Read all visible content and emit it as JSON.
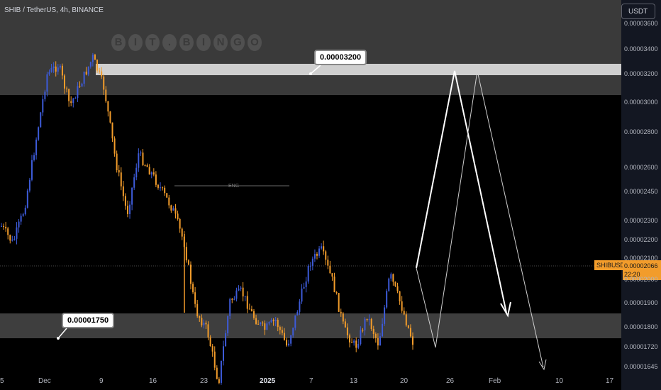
{
  "header": {
    "title": "SHIB / TetherUS, 4h, BINANCE",
    "currency_button": "USDT"
  },
  "watermark": [
    "B",
    "I",
    "T",
    ".",
    "B",
    "I",
    "N",
    "G",
    "O"
  ],
  "annotations": {
    "upper_callout": "0.00003200",
    "lower_callout": "0.00001750",
    "eng_label": "ENG"
  },
  "price_label": {
    "symbol": "SHIBUSDT",
    "price": "0.00002066",
    "timer": "22:20"
  },
  "colors": {
    "up_candle": "#3d5bd9",
    "down_candle": "#f29c2b",
    "zone": "#d0d0d0",
    "price_tag": "#f29c2b"
  },
  "chart_data": {
    "type": "candlestick",
    "y_ticks": [
      "0.00003600",
      "0.00003400",
      "0.00003200",
      "0.00003000",
      "0.00002800",
      "0.00002600",
      "0.00002450",
      "0.00002300",
      "0.00002200",
      "0.00002100",
      "0.00002000",
      "0.00001900",
      "0.00001800",
      "0.00001720",
      "0.00001645"
    ],
    "x_ticks": [
      "5",
      "Dec",
      "9",
      "16",
      "23",
      "2025",
      "7",
      "13",
      "20",
      "26",
      "Feb",
      "10",
      "17"
    ],
    "bold_x_ticks": [
      "2025"
    ],
    "resistance_zone": {
      "price": 3.2e-05,
      "label": "0.00003200"
    },
    "support_zone": {
      "price": 1.75e-05,
      "label": "0.00001750"
    },
    "last_price": 2.066e-05,
    "price_path": [
      2.55e-05,
      2.48e-05,
      2.62e-05,
      2.9e-05,
      3.18e-05,
      3.22e-05,
      3.05e-05,
      3.15e-05,
      3.25e-05,
      3.12e-05,
      2.82e-05,
      2.6e-05,
      2.85e-05,
      2.78e-05,
      2.7e-05,
      2.62e-05,
      2.48e-05,
      2.2e-05,
      2.12e-05,
      1.9e-05,
      2.24e-05,
      2.28e-05,
      2.18e-05,
      2.12e-05,
      2.16e-05,
      2.05e-05,
      2.22e-05,
      2.4e-05,
      2.45e-05,
      2.32e-05,
      2.12e-05,
      2.05e-05,
      2.18e-05,
      2.06e-05,
      2.35e-05,
      2.22e-05,
      2.07e-05
    ],
    "projection_bold": [
      2.07e-05,
      3.21e-05,
      1.87e-05
    ],
    "projection_thin": [
      2.07e-05,
      1.72e-05,
      3.21e-05,
      1.64e-05
    ]
  }
}
